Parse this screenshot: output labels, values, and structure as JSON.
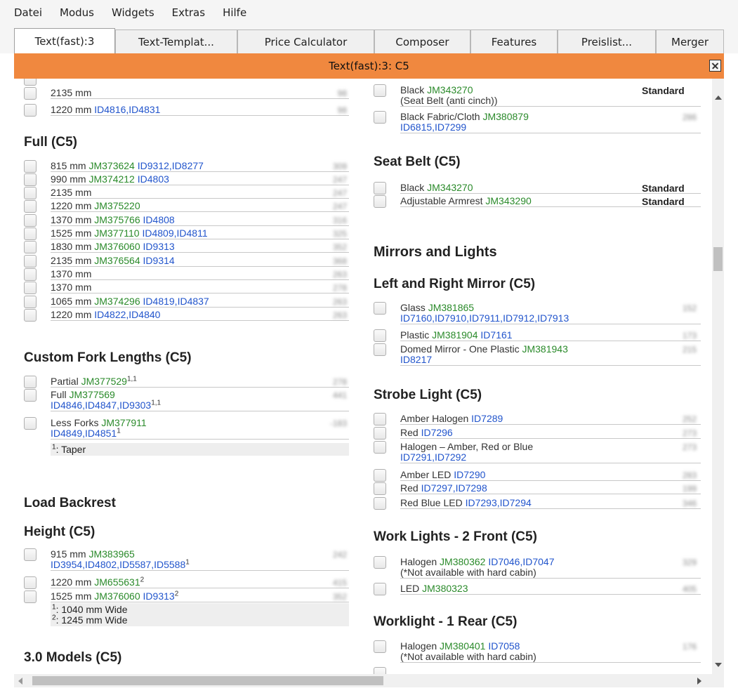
{
  "menu": [
    "Datei",
    "Modus",
    "Widgets",
    "Extras",
    "Hilfe"
  ],
  "tabs": [
    {
      "label": "Text(fast):3",
      "active": true
    },
    {
      "label": "Text-Templat...",
      "active": false
    },
    {
      "label": "Price Calculator",
      "active": false
    },
    {
      "label": "Composer",
      "active": false
    },
    {
      "label": "Features",
      "active": false
    },
    {
      "label": "Preislist...",
      "active": false
    },
    {
      "label": "Merger",
      "active": false
    }
  ],
  "title": "Text(fast):3: C5",
  "left": {
    "top_rows": [
      {
        "parts": [
          {
            "t": "2135 mm",
            "c": "txt"
          }
        ],
        "price": "98"
      },
      {
        "parts": [
          {
            "t": "1220 mm ",
            "c": "txt"
          },
          {
            "t": "ID4816,ID4831",
            "c": "id"
          }
        ],
        "price": "98"
      }
    ],
    "full": {
      "title": "Full (C5)",
      "rows": [
        {
          "parts": [
            {
              "t": "815 mm ",
              "c": "txt"
            },
            {
              "t": "JM373624",
              "c": "jm"
            },
            {
              "t": " ID9312,ID8277",
              "c": "id"
            }
          ],
          "price": "309"
        },
        {
          "parts": [
            {
              "t": "990 mm ",
              "c": "txt"
            },
            {
              "t": "JM374212",
              "c": "jm"
            },
            {
              "t": " ID4803",
              "c": "id"
            }
          ],
          "price": "247"
        },
        {
          "parts": [
            {
              "t": "2135 mm",
              "c": "txt"
            }
          ],
          "price": "247"
        },
        {
          "parts": [
            {
              "t": "1220 mm ",
              "c": "txt"
            },
            {
              "t": "JM375220",
              "c": "jm"
            }
          ],
          "price": "247"
        },
        {
          "parts": [
            {
              "t": "1370 mm ",
              "c": "txt"
            },
            {
              "t": "JM375766",
              "c": "jm"
            },
            {
              "t": " ID4808",
              "c": "id"
            }
          ],
          "price": "316"
        },
        {
          "parts": [
            {
              "t": "1525 mm ",
              "c": "txt"
            },
            {
              "t": "JM377110",
              "c": "jm"
            },
            {
              "t": " ID4809,ID4811",
              "c": "id"
            }
          ],
          "price": "325"
        },
        {
          "parts": [
            {
              "t": "1830 mm ",
              "c": "txt"
            },
            {
              "t": "JM376060",
              "c": "jm"
            },
            {
              "t": " ID9313",
              "c": "id"
            }
          ],
          "price": "352"
        },
        {
          "parts": [
            {
              "t": "2135 mm ",
              "c": "txt"
            },
            {
              "t": "JM376564",
              "c": "jm"
            },
            {
              "t": " ID9314",
              "c": "id"
            }
          ],
          "price": "368"
        },
        {
          "parts": [
            {
              "t": "1370 mm",
              "c": "txt"
            }
          ],
          "price": "263"
        },
        {
          "parts": [
            {
              "t": "1370 mm",
              "c": "txt"
            }
          ],
          "price": "278"
        },
        {
          "parts": [
            {
              "t": "1065 mm ",
              "c": "txt"
            },
            {
              "t": "JM374296",
              "c": "jm"
            },
            {
              "t": " ID4819,ID4837",
              "c": "id"
            }
          ],
          "price": "263"
        },
        {
          "parts": [
            {
              "t": "1220 mm ",
              "c": "txt"
            },
            {
              "t": "ID4822,ID4840",
              "c": "id"
            }
          ],
          "price": "263"
        }
      ]
    },
    "custom_fork": {
      "title": "Custom Fork Lengths (C5)",
      "rows": [
        {
          "parts": [
            {
              "t": "Partial ",
              "c": "txt"
            },
            {
              "t": "JM377529",
              "c": "jm"
            },
            {
              "t": "1,1",
              "c": "sup"
            }
          ],
          "price": "278"
        },
        {
          "parts": [
            {
              "t": "Full ",
              "c": "txt"
            },
            {
              "t": "JM377569",
              "c": "jm"
            }
          ],
          "line2": [
            {
              "t": "ID4846,ID4847,ID9303",
              "c": "id"
            },
            {
              "t": "1,1",
              "c": "sup"
            }
          ],
          "price": "441"
        },
        {
          "parts": [
            {
              "t": "Less Forks ",
              "c": "txt"
            },
            {
              "t": "JM377911",
              "c": "jm"
            }
          ],
          "line2": [
            {
              "t": "ID4849,ID4851",
              "c": "id"
            },
            {
              "t": "1",
              "c": "sup"
            }
          ],
          "price": "-183"
        }
      ],
      "notes": [
        {
          "sup": "1",
          "text": ": Taper"
        }
      ]
    },
    "load_backrest": {
      "title": "Load Backrest"
    },
    "height": {
      "title": "Height (C5)",
      "rows": [
        {
          "parts": [
            {
              "t": "915 mm ",
              "c": "txt"
            },
            {
              "t": "JM383965",
              "c": "jm"
            }
          ],
          "line2": [
            {
              "t": "ID3954,ID4802,ID5587,ID5588",
              "c": "id"
            },
            {
              "t": "1",
              "c": "sup"
            }
          ],
          "price": "242"
        },
        {
          "parts": [
            {
              "t": "1220 mm ",
              "c": "txt"
            },
            {
              "t": "JM655631",
              "c": "jm"
            },
            {
              "t": "2",
              "c": "sup"
            }
          ],
          "price": "415"
        },
        {
          "parts": [
            {
              "t": "1525 mm ",
              "c": "txt"
            },
            {
              "t": "JM376060",
              "c": "jm"
            },
            {
              "t": " ID9313",
              "c": "id"
            },
            {
              "t": "2",
              "c": "sup"
            }
          ],
          "price": "352"
        }
      ],
      "notes": [
        {
          "sup": "1",
          "text": ": 1040 mm Wide"
        },
        {
          "sup": "2",
          "text": ": 1245 mm Wide"
        }
      ]
    },
    "models": {
      "title": "3.0 Models (C5)"
    }
  },
  "right": {
    "top_rows": [
      {
        "parts": [
          {
            "t": "Black ",
            "c": "txt"
          },
          {
            "t": "JM343270",
            "c": "jm"
          }
        ],
        "line2": [
          {
            "t": "(Seat Belt (anti cinch))",
            "c": "txt"
          }
        ],
        "std": "Standard"
      },
      {
        "parts": [
          {
            "t": "Black Fabric/Cloth ",
            "c": "txt"
          },
          {
            "t": "JM380879",
            "c": "jm"
          }
        ],
        "line2": [
          {
            "t": "ID6815,ID7299",
            "c": "id"
          }
        ],
        "price": "286"
      }
    ],
    "seat_belt": {
      "title": "Seat Belt (C5)",
      "rows": [
        {
          "parts": [
            {
              "t": "Black ",
              "c": "txt"
            },
            {
              "t": "JM343270",
              "c": "jm"
            }
          ],
          "std": "Standard"
        },
        {
          "parts": [
            {
              "t": "Adjustable Armrest ",
              "c": "txt"
            },
            {
              "t": "JM343290",
              "c": "jm"
            }
          ],
          "std": "Standard"
        }
      ]
    },
    "mirrors": {
      "title": "Mirrors and Lights"
    },
    "lr_mirror": {
      "title": "Left and Right Mirror (C5)",
      "rows": [
        {
          "parts": [
            {
              "t": "Glass ",
              "c": "txt"
            },
            {
              "t": "JM381865",
              "c": "jm"
            }
          ],
          "line2": [
            {
              "t": "ID7160,ID7910,ID7911,ID7912,ID7913",
              "c": "id"
            }
          ],
          "price": "152"
        },
        {
          "parts": [
            {
              "t": "Plastic ",
              "c": "txt"
            },
            {
              "t": "JM381904",
              "c": "jm"
            },
            {
              "t": " ID7161",
              "c": "id"
            }
          ],
          "price": "173"
        },
        {
          "parts": [
            {
              "t": "Domed Mirror - One Plastic ",
              "c": "txt"
            },
            {
              "t": "JM381943",
              "c": "jm"
            }
          ],
          "line2": [
            {
              "t": "ID8217",
              "c": "id"
            }
          ],
          "price": "215"
        }
      ]
    },
    "strobe": {
      "title": "Strobe Light (C5)",
      "rows": [
        {
          "parts": [
            {
              "t": "Amber Halogen ",
              "c": "txt"
            },
            {
              "t": "ID7289",
              "c": "id"
            }
          ],
          "price": "252"
        },
        {
          "parts": [
            {
              "t": "Red ",
              "c": "txt"
            },
            {
              "t": "ID7296",
              "c": "id"
            }
          ],
          "price": "273"
        },
        {
          "parts": [
            {
              "t": "Halogen – Amber, Red or Blue",
              "c": "txt"
            }
          ],
          "line2": [
            {
              "t": "ID7291,ID7292",
              "c": "id"
            }
          ],
          "price": "273"
        },
        {
          "parts": [
            {
              "t": "Amber LED ",
              "c": "txt"
            },
            {
              "t": "ID7290",
              "c": "id"
            }
          ],
          "price": "283"
        },
        {
          "parts": [
            {
              "t": "Red ",
              "c": "txt"
            },
            {
              "t": "ID7297,ID7298",
              "c": "id"
            }
          ],
          "price": "199"
        },
        {
          "parts": [
            {
              "t": "Red Blue LED ",
              "c": "txt"
            },
            {
              "t": "ID7293,ID7294",
              "c": "id"
            }
          ],
          "price": "346"
        }
      ]
    },
    "work_front": {
      "title": "Work Lights - 2 Front (C5)",
      "rows": [
        {
          "parts": [
            {
              "t": "Halogen ",
              "c": "txt"
            },
            {
              "t": "JM380362",
              "c": "jm"
            },
            {
              "t": " ID7046,ID7047",
              "c": "id"
            }
          ],
          "line2": [
            {
              "t": "(*Not available with hard cabin)",
              "c": "txt"
            }
          ],
          "price": "329"
        },
        {
          "parts": [
            {
              "t": "LED ",
              "c": "txt"
            },
            {
              "t": "JM380323",
              "c": "jm"
            }
          ],
          "price": "405"
        }
      ]
    },
    "work_rear": {
      "title": "Worklight - 1 Rear (C5)",
      "rows": [
        {
          "parts": [
            {
              "t": "Halogen ",
              "c": "txt"
            },
            {
              "t": "JM380401",
              "c": "jm"
            },
            {
              "t": " ID7058",
              "c": "id"
            }
          ],
          "line2": [
            {
              "t": "(*Not available with hard cabin)",
              "c": "txt"
            }
          ],
          "price": "176"
        }
      ]
    }
  },
  "colors": {
    "titlebar": "#f0883f",
    "jm": "#2a8a2a",
    "id": "#2255cc"
  }
}
